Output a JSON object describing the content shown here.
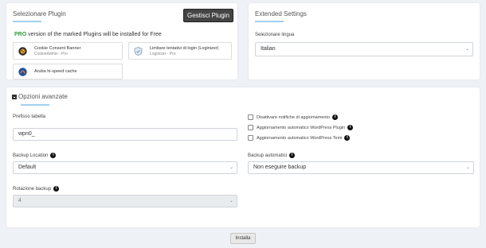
{
  "plugins_card": {
    "title": "Selezionare Plugin",
    "manage_button": "Gestisci Plugin",
    "pro_badge": "PRO",
    "pro_text": " version of the marked Plugins will be installed for Free",
    "plugins": [
      {
        "name": "Cookie Consent Banner",
        "sub": "CookieAdmin - Pro",
        "icon": "cookie-admin-icon"
      },
      {
        "name": "Limitare tentativi di login (Loginizer)",
        "sub": "Loginizer - Pro",
        "icon": "loginizer-shield-icon"
      },
      {
        "name": "Aruba hi-speed cache",
        "sub": "",
        "icon": "aruba-icon"
      }
    ]
  },
  "extended_card": {
    "title": "Extended Settings",
    "language_label": "Selezionare lingua",
    "language_value": "Italian"
  },
  "advanced_card": {
    "title": "Opzioni avanzate",
    "prefix_label": "Prefisso tabella",
    "prefix_value": "wpn0_",
    "checkboxes": [
      "Disattivare notifiche di aggiornamento",
      "Aggiornamento automatico WordPress Plugin",
      "Aggiornamento automatico WordPress Temi"
    ],
    "backup_location_label": "Backup Location",
    "backup_location_value": "Default",
    "auto_backup_label": "Backup automatici",
    "auto_backup_value": "Non eseguire backup",
    "rotation_label": "Rotazione backup",
    "rotation_value": "4"
  },
  "install_button": "Installa",
  "colors": {
    "accent_underline": "#9fd0f0",
    "pro_green": "#2f9a3b",
    "page_bg": "#eef1f5"
  }
}
